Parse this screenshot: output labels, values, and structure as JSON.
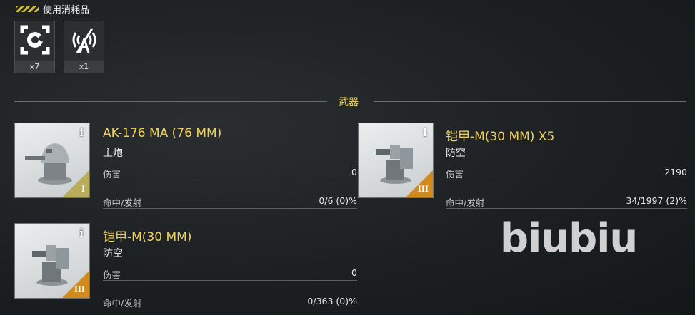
{
  "consumables": {
    "title": "使用消耗品",
    "items": [
      {
        "icon": "repair-wrench-icon",
        "count": "x7"
      },
      {
        "icon": "radio-tower-crossed-icon",
        "count": "x1"
      }
    ]
  },
  "weapons": {
    "title": "武器",
    "stat_labels": {
      "damage": "伤害",
      "hit": "命中/发射"
    },
    "items": [
      {
        "name": "AK-176 MA (76 MM)",
        "type": "主炮",
        "tier": "I",
        "damage": "0",
        "hits": "0/6 (0)%",
        "tier_color": "#b8ad5a"
      },
      {
        "name": "铠甲-M(30 MM) X5",
        "type": "防空",
        "tier": "III",
        "damage": "2190",
        "hits": "34/1997 (2)%",
        "tier_color": "#d08a1e"
      },
      {
        "name": "铠甲-M(30 MM)",
        "type": "防空",
        "tier": "III",
        "damage": "0",
        "hits": "0/363 (0)%",
        "tier_color": "#d08a1e"
      }
    ]
  },
  "watermark": "biubiu"
}
